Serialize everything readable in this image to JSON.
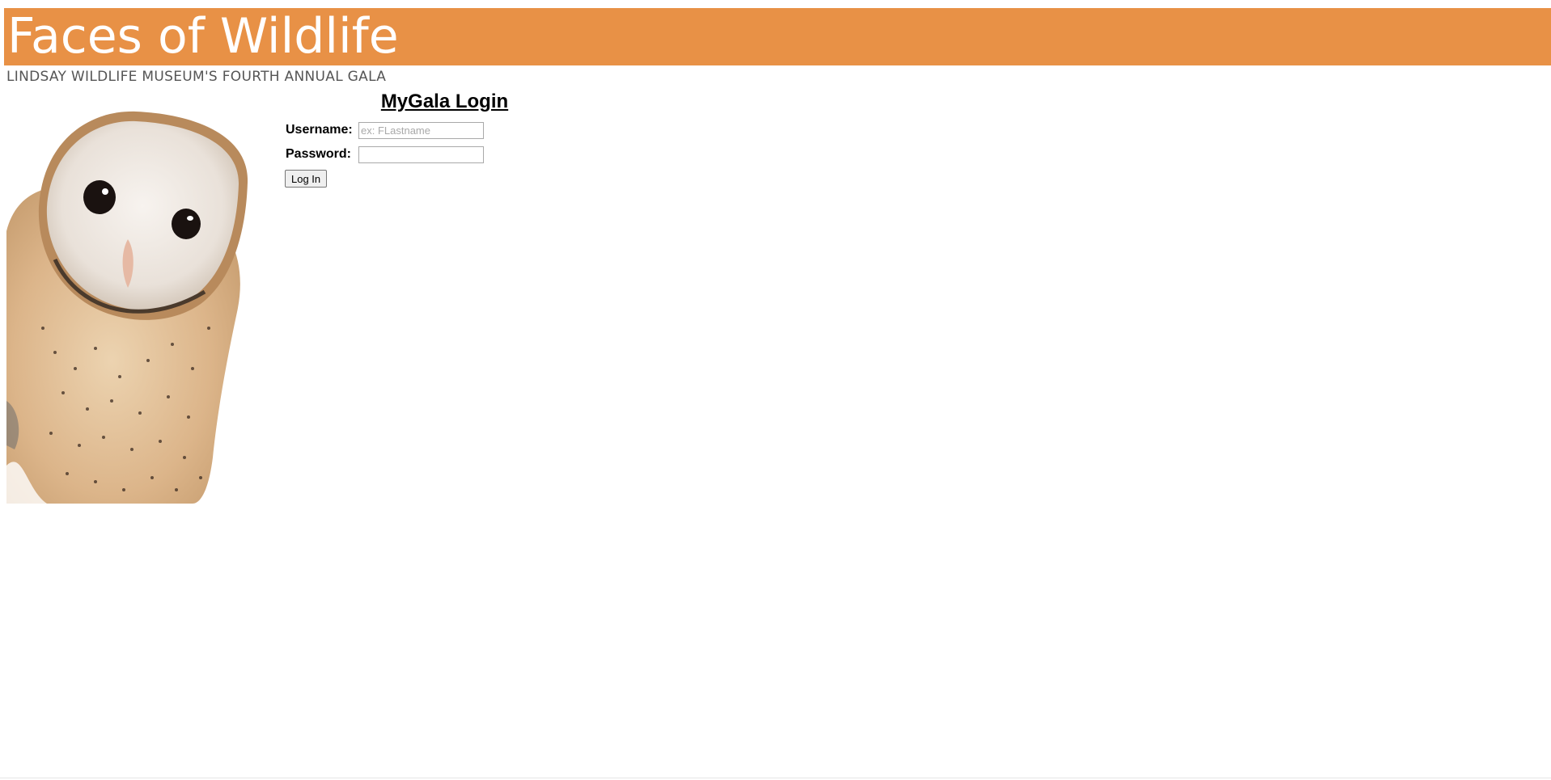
{
  "header": {
    "title": "Faces of Wildlife",
    "subtitle": "LINDSAY WILDLIFE MUSEUM'S FOURTH ANNUAL GALA",
    "banner_color": "#e89146"
  },
  "login": {
    "heading": "MyGala Login",
    "username_label": "Username:",
    "username_placeholder": "ex: FLastname",
    "username_value": "",
    "password_label": "Password:",
    "password_value": "",
    "submit_label": "Log In"
  }
}
